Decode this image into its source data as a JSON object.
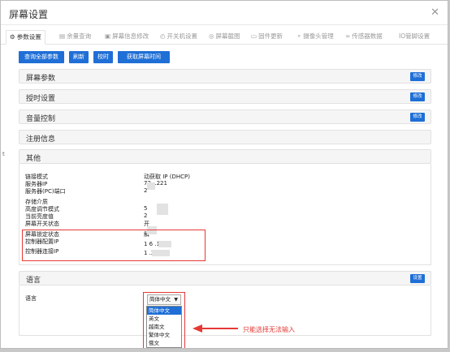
{
  "dialog": {
    "title": "屏幕设置",
    "close": "✕"
  },
  "tabs": [
    {
      "icon": "⚙",
      "label": "参数设置",
      "active": true
    },
    {
      "icon": "▤",
      "label": "余量查询"
    },
    {
      "icon": "▣",
      "label": "屏幕信息修改"
    },
    {
      "icon": "◴",
      "label": "开关机设置"
    },
    {
      "icon": "◎",
      "label": "屏幕截图"
    },
    {
      "icon": "▭",
      "label": "固件更新"
    },
    {
      "icon": "⚬",
      "label": "摄像头管理"
    },
    {
      "icon": "≈",
      "label": "传感器数据"
    },
    {
      "icon": "",
      "label": "IO管脚设置"
    }
  ],
  "toolbar": {
    "query_all": "查询全部参数",
    "refresh": "刷新",
    "calibrate": "校时",
    "get_time": "获取屏幕时间"
  },
  "panels": {
    "screen_params": {
      "label": "屏幕参数",
      "btn": "修改"
    },
    "auth": {
      "label": "授时设置",
      "btn": "修改"
    },
    "volume": {
      "label": "音量控制",
      "btn": "修改"
    },
    "register": {
      "label": "注册信息"
    },
    "other": {
      "label": "其他"
    },
    "language": {
      "label": "语言",
      "btn": "设置"
    }
  },
  "other_info": {
    "labels": [
      "链接模式",
      "服务器IP",
      "服务器(PC)端口",
      "存储介质",
      "高度调节模式",
      "当前亮度值",
      "屏幕开关状态",
      "屏幕锁定状态",
      "控制器配置IP",
      "控制器连接IP"
    ],
    "values": [
      "动获取 IP (DHCP)",
      "72.  .221",
      "2",
      "",
      "5",
      "2",
      "开",
      "解",
      "1    6   .199",
      "1        .219"
    ]
  },
  "language": {
    "field_label": "语言",
    "selected": "简体中文",
    "options": [
      "简体中文",
      "英文",
      "越南文",
      "繁体中文",
      "俄文"
    ]
  },
  "annotation": "只能选择无法输入",
  "side_mark": "t"
}
